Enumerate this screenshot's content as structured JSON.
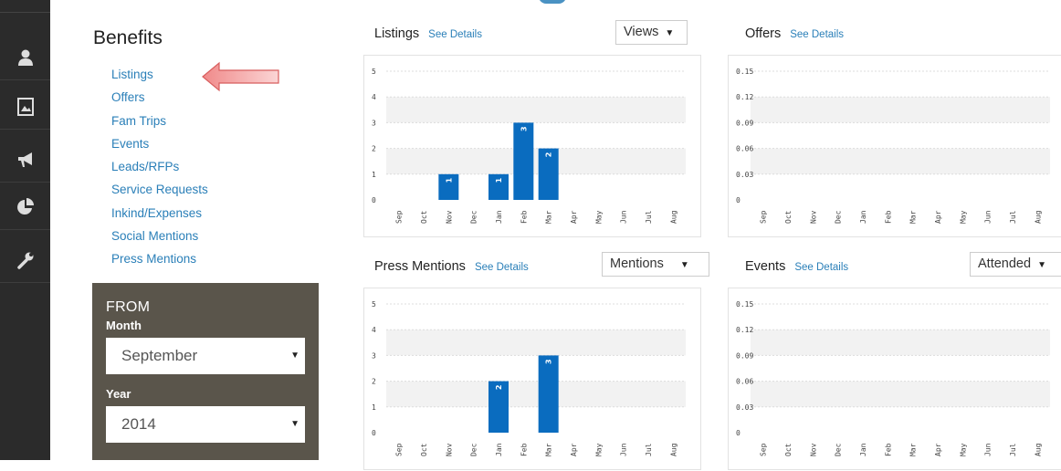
{
  "rail": {
    "icons": [
      "user-icon",
      "image-icon",
      "megaphone-icon",
      "pie-chart-icon",
      "wrench-icon"
    ]
  },
  "sidebar": {
    "title": "Benefits",
    "links": [
      "Listings",
      "Offers",
      "Fam Trips",
      "Events",
      "Leads/RFPs",
      "Service Requests",
      "Inkind/Expenses",
      "Social Mentions",
      "Press Mentions"
    ]
  },
  "filter": {
    "from_label": "FROM",
    "month_label": "Month",
    "month_value": "September",
    "year_label": "Year",
    "year_value": "2014"
  },
  "panels": {
    "listings": {
      "title": "Listings",
      "see": "See Details",
      "dropdown": "Views"
    },
    "offers": {
      "title": "Offers",
      "see": "See Details"
    },
    "press": {
      "title": "Press Mentions",
      "see": "See Details",
      "dropdown": "Mentions"
    },
    "events": {
      "title": "Events",
      "see": "See Details",
      "dropdown": "Attended"
    }
  },
  "chart_data": [
    {
      "type": "bar",
      "id": "listings",
      "categories": [
        "Sep",
        "Oct",
        "Nov",
        "Dec",
        "Jan",
        "Feb",
        "Mar",
        "Apr",
        "May",
        "Jun",
        "Jul",
        "Aug"
      ],
      "values": [
        0,
        0,
        1,
        0,
        1,
        3,
        2,
        0,
        0,
        0,
        0,
        0
      ],
      "ylim": [
        0,
        5
      ],
      "yticks": [
        "0",
        "1",
        "2",
        "3",
        "4",
        "5"
      ],
      "grid": true
    },
    {
      "type": "bar",
      "id": "offers",
      "categories": [
        "Sep",
        "Oct",
        "Nov",
        "Dec",
        "Jan",
        "Feb",
        "Mar",
        "Apr",
        "May",
        "Jun",
        "Jul",
        "Aug"
      ],
      "values": [
        0,
        0,
        0,
        0,
        0,
        0,
        0,
        0,
        0,
        0,
        0,
        0
      ],
      "ylim": [
        0,
        0.15
      ],
      "yticks": [
        "0",
        "0.03",
        "0.06",
        "0.09",
        "0.12",
        "0.15"
      ],
      "grid": true
    },
    {
      "type": "bar",
      "id": "press",
      "categories": [
        "Sep",
        "Oct",
        "Nov",
        "Dec",
        "Jan",
        "Feb",
        "Mar",
        "Apr",
        "May",
        "Jun",
        "Jul",
        "Aug"
      ],
      "values": [
        0,
        0,
        0,
        0,
        2,
        0,
        3,
        0,
        0,
        0,
        0,
        0
      ],
      "ylim": [
        0,
        5
      ],
      "yticks": [
        "0",
        "1",
        "2",
        "3",
        "4",
        "5"
      ],
      "grid": true
    },
    {
      "type": "bar",
      "id": "events",
      "categories": [
        "Sep",
        "Oct",
        "Nov",
        "Dec",
        "Jan",
        "Feb",
        "Mar",
        "Apr",
        "May",
        "Jun",
        "Jul",
        "Aug"
      ],
      "values": [
        0,
        0,
        0,
        0,
        0,
        0,
        0,
        0,
        0,
        0,
        0,
        0
      ],
      "ylim": [
        0,
        0.15
      ],
      "yticks": [
        "0",
        "0.03",
        "0.06",
        "0.09",
        "0.12",
        "0.15"
      ],
      "grid": true
    }
  ],
  "colors": {
    "bar": "#0a6cbf",
    "link": "#2a7fb8",
    "filter_bg": "#5a554b",
    "rail_bg": "#2b2b2b"
  }
}
